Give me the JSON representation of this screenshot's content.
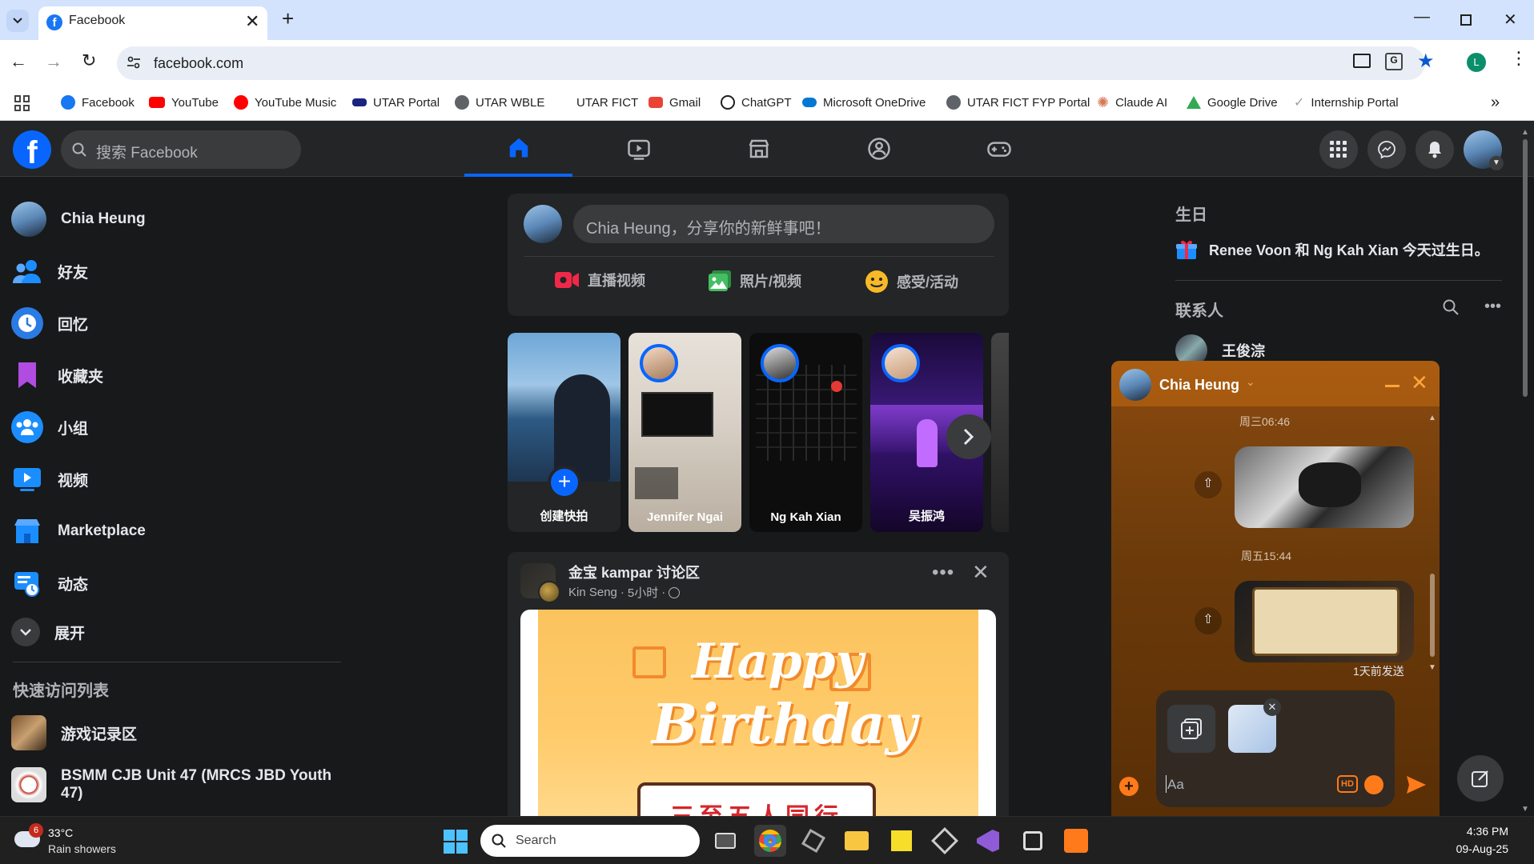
{
  "browser": {
    "tab_title": "Facebook",
    "url": "facebook.com",
    "profile_initial": "L",
    "bookmarks": [
      {
        "label": "Facebook",
        "icon": "facebook-icon",
        "color": "#1877f2"
      },
      {
        "label": "YouTube",
        "icon": "youtube-icon",
        "color": "#ff0000"
      },
      {
        "label": "YouTube Music",
        "icon": "youtube-music-icon",
        "color": "#ff0000"
      },
      {
        "label": "UTAR Portal",
        "icon": "utar-icon",
        "color": "#1a237e"
      },
      {
        "label": "UTAR WBLE",
        "icon": "globe-icon",
        "color": "#5f6368"
      },
      {
        "label": "UTAR FICT",
        "icon": "blank-icon",
        "color": "#ffffff"
      },
      {
        "label": "Gmail",
        "icon": "gmail-icon",
        "color": "#ea4335"
      },
      {
        "label": "ChatGPT",
        "icon": "chatgpt-icon",
        "color": "#1f1f1f"
      },
      {
        "label": "Microsoft OneDrive",
        "icon": "onedrive-icon",
        "color": "#0078d4"
      },
      {
        "label": "UTAR FICT FYP Portal",
        "icon": "globe-icon",
        "color": "#5f6368"
      },
      {
        "label": "Claude AI",
        "icon": "claude-icon",
        "color": "#d97757"
      },
      {
        "label": "Google Drive",
        "icon": "google-drive-icon",
        "color": "#34a853"
      },
      {
        "label": "Internship Portal",
        "icon": "internship-icon",
        "color": "#9aa0a6"
      }
    ]
  },
  "facebook": {
    "search_placeholder": "搜索 Facebook",
    "accent": "#0866ff",
    "sidebar": {
      "items": [
        {
          "label": "Chia Heung",
          "icon": "profile-avatar"
        },
        {
          "label": "好友",
          "icon": "friends-icon"
        },
        {
          "label": "回忆",
          "icon": "memories-icon"
        },
        {
          "label": "收藏夹",
          "icon": "saved-icon"
        },
        {
          "label": "小组",
          "icon": "groups-icon"
        },
        {
          "label": "视频",
          "icon": "video-icon"
        },
        {
          "label": "Marketplace",
          "icon": "marketplace-icon"
        },
        {
          "label": "动态",
          "icon": "feeds-icon"
        },
        {
          "label": "展开",
          "icon": "chevron-down-icon"
        }
      ],
      "shortcuts_title": "快速访问列表",
      "shortcuts": [
        {
          "label": "游戏记录区"
        },
        {
          "label": "BSMM CJB Unit 47 (MRCS JBD Youth 47)"
        }
      ]
    },
    "composer": {
      "placeholder": "Chia Heung，分享你的新鲜事吧！",
      "actions": [
        {
          "label": "直播视频",
          "icon": "live-video-icon",
          "color": "#f02849"
        },
        {
          "label": "照片/视频",
          "icon": "photo-icon",
          "color": "#45bd62"
        },
        {
          "label": "感受/活动",
          "icon": "feeling-icon",
          "color": "#f7b928"
        }
      ]
    },
    "stories": [
      {
        "label": "创建快拍"
      },
      {
        "label": "Jennifer Ngai"
      },
      {
        "label": "Ng Kah Xian"
      },
      {
        "label": "吴振鸿"
      }
    ],
    "post": {
      "group_name": "金宝 kampar 讨论区",
      "author": "Kin Seng",
      "meta": "5小时",
      "image_text_1": "Happy",
      "image_text_2": "Birthday",
      "image_banner": "三至五人同行"
    },
    "right": {
      "birthday_title": "生日",
      "birthday_text": "Renee Voon 和 Ng Kah Xian 今天过生日。",
      "contacts_title": "联系人",
      "contacts": [
        {
          "name": "王俊淙"
        }
      ]
    },
    "chat": {
      "name": "Chia Heung",
      "time_1": "周三06:46",
      "time_2": "周五15:44",
      "status": "1天前发送",
      "input_placeholder": "Aa",
      "hd_label": "HD"
    }
  },
  "taskbar": {
    "weather_temp": "33°C",
    "weather_desc": "Rain showers",
    "weather_badge": "6",
    "search_placeholder": "Search",
    "time": "4:36 PM",
    "date": "09-Aug-25"
  }
}
